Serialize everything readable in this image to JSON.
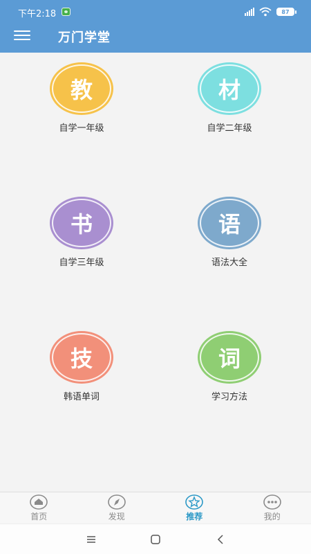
{
  "status_bar": {
    "time": "下午2:18",
    "battery": "87"
  },
  "header": {
    "title": "万门学堂"
  },
  "tiles": [
    {
      "glyph": "教",
      "label": "自学一年级",
      "color": "#f6c24a"
    },
    {
      "glyph": "材",
      "label": "自学二年级",
      "color": "#7ddfe0"
    },
    {
      "glyph": "书",
      "label": "自学三年级",
      "color": "#a98fd0"
    },
    {
      "glyph": "语",
      "label": "语法大全",
      "color": "#7ea9cc"
    },
    {
      "glyph": "技",
      "label": "韩语单词",
      "color": "#f2907a"
    },
    {
      "glyph": "词",
      "label": "学习方法",
      "color": "#8fce73"
    }
  ],
  "tab_bar": {
    "tabs": [
      {
        "label": "首页",
        "icon": "home-icon",
        "active": false
      },
      {
        "label": "发现",
        "icon": "compass-icon",
        "active": false
      },
      {
        "label": "推荐",
        "icon": "star-icon",
        "active": true
      },
      {
        "label": "我的",
        "icon": "more-icon",
        "active": false
      }
    ]
  },
  "nav_bar": {
    "buttons": [
      "menu-icon",
      "home-square-icon",
      "back-icon"
    ]
  }
}
